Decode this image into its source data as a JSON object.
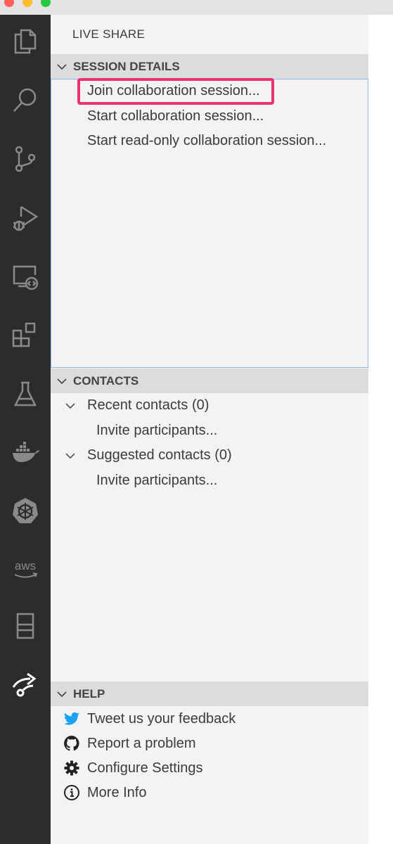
{
  "sidebar": {
    "title": "LIVE SHARE",
    "session": {
      "header": "SESSION DETAILS",
      "items": [
        "Join collaboration session...",
        "Start collaboration session...",
        "Start read-only collaboration session..."
      ]
    },
    "contacts": {
      "header": "CONTACTS",
      "recent": "Recent contacts (0)",
      "recent_invite": "Invite participants...",
      "suggested": "Suggested contacts (0)",
      "suggested_invite": "Invite participants..."
    },
    "help": {
      "header": "HELP",
      "items": [
        {
          "label": "Tweet us your feedback",
          "icon": "twitter-icon"
        },
        {
          "label": "Report a problem",
          "icon": "github-icon"
        },
        {
          "label": "Configure Settings",
          "icon": "gear-icon"
        },
        {
          "label": "More Info",
          "icon": "info-icon"
        }
      ]
    }
  },
  "activity_bar": {
    "icons": [
      "explorer-icon",
      "search-icon",
      "source-control-icon",
      "run-debug-icon",
      "remote-explorer-icon",
      "extensions-icon",
      "testing-icon",
      "docker-icon",
      "kubernetes-icon",
      "aws-icon",
      "dock-icon",
      "live-share-icon"
    ],
    "aws_text": "aws"
  },
  "colors": {
    "activity_bar": "#2c2c2c",
    "sidebar": "#f3f3f3",
    "section_header": "#dcdcdc",
    "highlight": "#e9346d",
    "focus_border": "#8fb8e8",
    "twitter_blue": "#1da1f2"
  }
}
